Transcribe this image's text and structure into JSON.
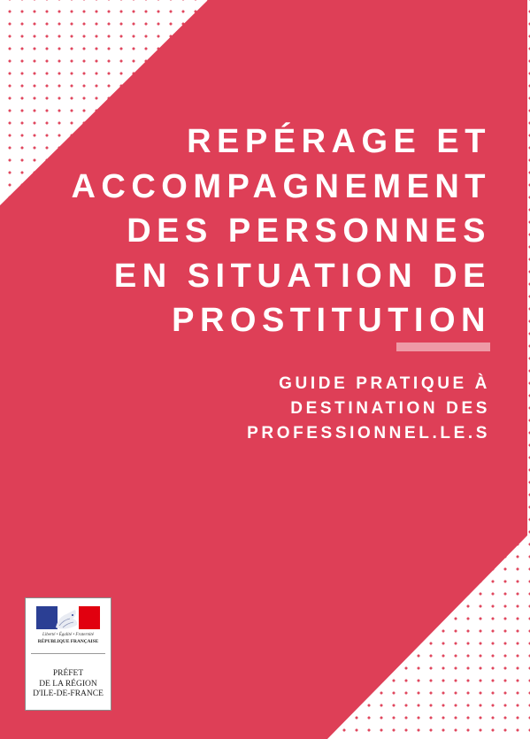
{
  "cover": {
    "title_lines": [
      "REPÉRAGE ET",
      "ACCOMPAGNEMENT",
      "DES PERSONNES",
      "EN SITUATION DE",
      "PROSTITUTION"
    ],
    "subtitle_lines": [
      "GUIDE PRATIQUE À",
      "DESTINATION DES",
      "PROFESSIONNEL.LE.S"
    ]
  },
  "logo": {
    "motto": "Liberté • Égalité • Fraternité",
    "republic": "RÉPUBLIQUE FRANÇAISE",
    "prefect_lines": [
      "PRÉFET",
      "DE LA RÉGION",
      "D'ILE-DE-FRANCE"
    ]
  },
  "colors": {
    "accent": "#de3f57",
    "separator": "#ee9aa6",
    "flag_blue": "#2b3f94",
    "flag_red": "#e1000f"
  }
}
